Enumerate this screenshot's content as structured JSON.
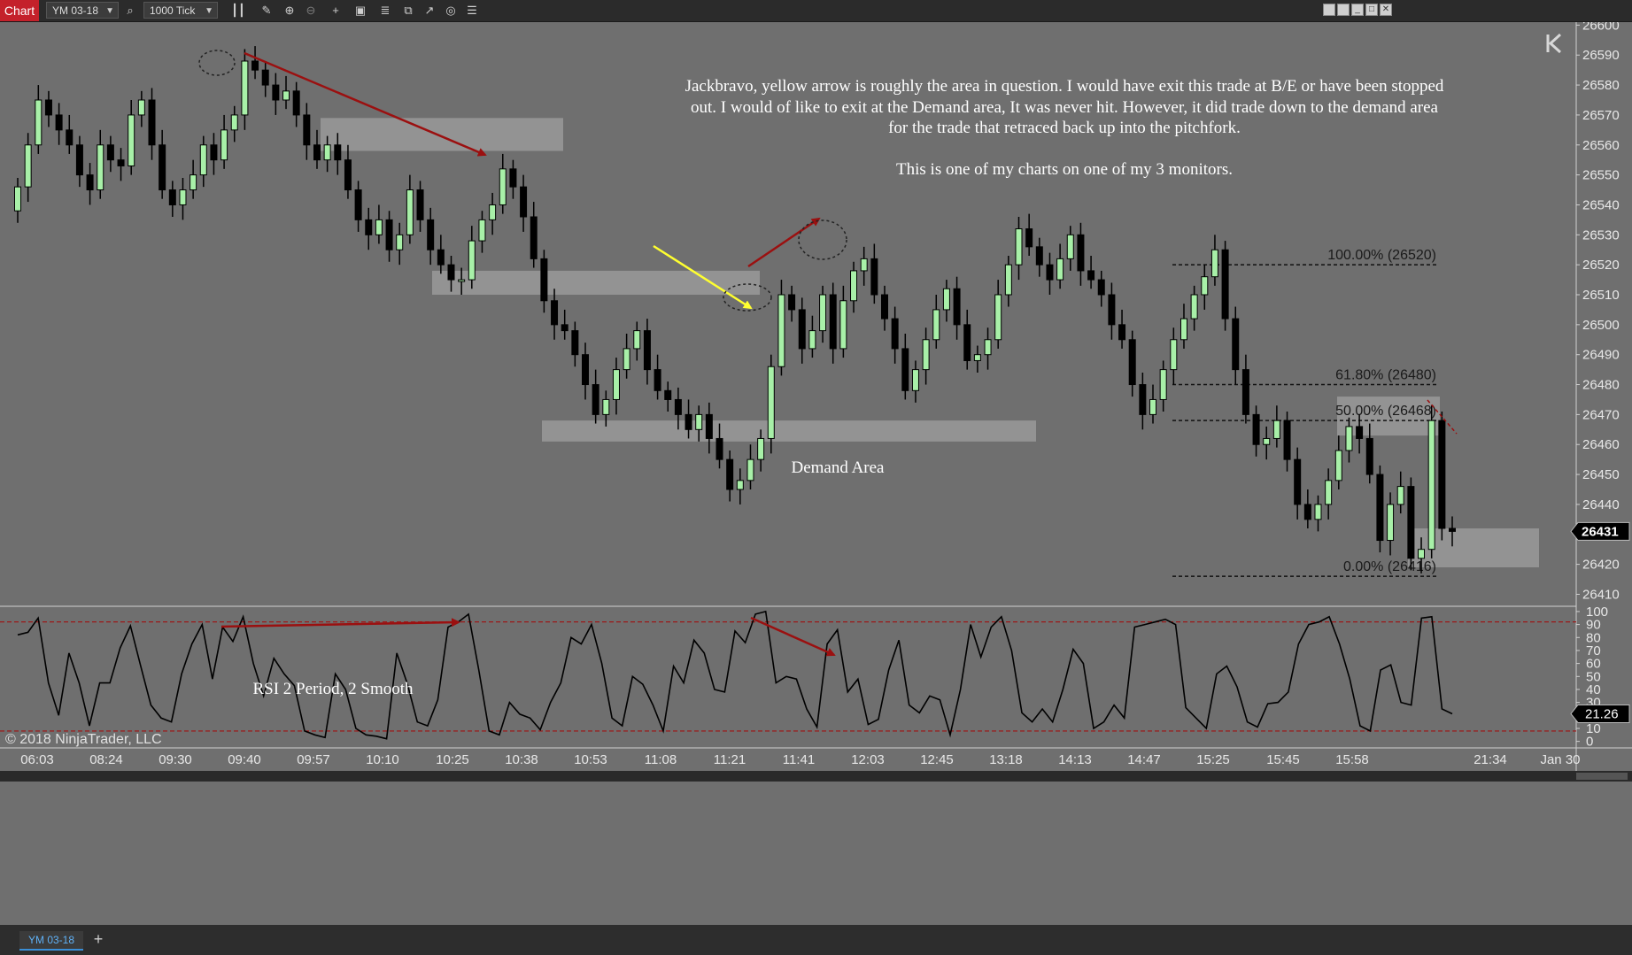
{
  "toolbar": {
    "chart_tab": "Chart",
    "instrument": "YM 03-18",
    "interval": "1000 Tick"
  },
  "bottom": {
    "instrument_tab": "YM 03-18",
    "add_tab": "+"
  },
  "annotations": {
    "note_lines": [
      "Jackbravo, yellow arrow is roughly the area in question.  I would have exit this trade at B/E or have been stopped",
      "out. I would of like to exit at the Demand area, It was never hit. However, it did trade down to the demand area",
      "for the trade that retraced back up into the pitchfork.",
      "",
      "This is one of my charts on one of my 3 monitors."
    ],
    "demand_label": "Demand Area",
    "rsi_label": "RSI 2 Period, 2 Smooth",
    "copyright": "© 2018 NinjaTrader, LLC"
  },
  "colors": {
    "background": "#6f6f6f",
    "up_candle": "#a8f0a8",
    "down_candle": "#000000",
    "zone": "#9a9a9a",
    "red_arrow": "#9b1010",
    "yellow_arrow": "#ffff30",
    "rsi_line": "#000000",
    "rsi_level": "#a01010"
  },
  "chart_data": [
    {
      "type": "candlestick",
      "y_axis_ticks": [
        26600,
        26590,
        26580,
        26570,
        26560,
        26550,
        26540,
        26530,
        26520,
        26510,
        26500,
        26490,
        26480,
        26470,
        26460,
        26450,
        26440,
        26430,
        26420,
        26410
      ],
      "ylim": [
        26406,
        26601
      ],
      "last_price": "26431",
      "x_tick_labels": [
        "06:03",
        "08:24",
        "09:30",
        "09:40",
        "09:57",
        "10:10",
        "10:25",
        "10:38",
        "10:53",
        "11:08",
        "11:21",
        "11:41",
        "12:03",
        "12:45",
        "13:18",
        "14:13",
        "14:47",
        "15:25",
        "15:45",
        "15:58",
        "21:34",
        "Jan 30"
      ],
      "fib_levels": [
        {
          "label": "100.00% (26520)",
          "price": 26520
        },
        {
          "label": "61.80% (26480)",
          "price": 26480
        },
        {
          "label": "50.00% (26468)",
          "price": 26468
        },
        {
          "label": "0.00% (26416)",
          "price": 26416
        }
      ],
      "zones": [
        {
          "price_low": 26558,
          "price_high": 26569
        },
        {
          "price_low": 26510,
          "price_high": 26518
        },
        {
          "price_low": 26461,
          "price_high": 26468
        },
        {
          "price_low": 26419,
          "price_high": 26432
        },
        {
          "price_low": 26463,
          "price_high": 26476
        }
      ],
      "close": [
        26546,
        26560,
        26575,
        26570,
        26565,
        26560,
        26550,
        26545,
        26560,
        26555,
        26553,
        26570,
        26575,
        26560,
        26545,
        26540,
        26545,
        26550,
        26560,
        26555,
        26565,
        26570,
        26588,
        26585,
        26580,
        26575,
        26578,
        26570,
        26560,
        26555,
        26560,
        26555,
        26545,
        26535,
        26530,
        26535,
        26525,
        26530,
        26545,
        26535,
        26525,
        26520,
        26515,
        26515,
        26528,
        26535,
        26540,
        26552,
        26546,
        26536,
        26522,
        26508,
        26500,
        26498,
        26490,
        26480,
        26470,
        26475,
        26485,
        26492,
        26498,
        26485,
        26478,
        26475,
        26470,
        26465,
        26470,
        26462,
        26455,
        26445,
        26448,
        26455,
        26462,
        26486,
        26510,
        26505,
        26492,
        26498,
        26510,
        26492,
        26508,
        26518,
        26522,
        26510,
        26502,
        26492,
        26478,
        26485,
        26495,
        26505,
        26512,
        26500,
        26488,
        26490,
        26495,
        26510,
        26520,
        26532,
        26526,
        26520,
        26515,
        26522,
        26530,
        26518,
        26515,
        26510,
        26500,
        26495,
        26480,
        26470,
        26475,
        26485,
        26495,
        26502,
        26510,
        26516,
        26525,
        26502,
        26485,
        26470,
        26460,
        26462,
        26468,
        26455,
        26440,
        26435,
        26440,
        26448,
        26458,
        26466,
        26462,
        26450,
        26428,
        26440,
        26446,
        26422,
        26425,
        26468,
        26432,
        26431
      ]
    },
    {
      "type": "line",
      "name": "RSI 2 Period, 2 Smooth",
      "y_axis_ticks": [
        100,
        90,
        80,
        70,
        60,
        50,
        40,
        30,
        20,
        10,
        0
      ],
      "ylim": [
        -5,
        102
      ],
      "levels": [
        92,
        8
      ],
      "last_value": "21.26",
      "values": [
        82,
        84,
        95,
        45,
        20,
        68,
        45,
        12,
        45,
        45,
        72,
        89,
        58,
        28,
        18,
        15,
        52,
        75,
        90,
        48,
        88,
        77,
        96,
        60,
        35,
        64,
        52,
        43,
        8,
        5,
        3,
        52,
        40,
        10,
        5,
        4,
        2,
        68,
        45,
        15,
        12,
        32,
        88,
        92,
        98,
        55,
        8,
        5,
        30,
        21,
        18,
        9,
        30,
        45,
        80,
        75,
        90,
        60,
        18,
        12,
        50,
        44,
        28,
        8,
        58,
        45,
        78,
        68,
        40,
        38,
        85,
        76,
        98,
        100,
        45,
        50,
        48,
        25,
        11,
        75,
        86,
        38,
        48,
        13,
        17,
        55,
        78,
        28,
        22,
        35,
        32,
        5,
        40,
        90,
        65,
        88,
        96,
        70,
        22,
        15,
        25,
        15,
        40,
        71,
        60,
        10,
        15,
        28,
        18,
        88,
        90,
        92,
        94,
        90,
        26,
        18,
        10,
        52,
        58,
        42,
        15,
        11,
        29,
        30,
        38,
        75,
        90,
        92,
        96,
        75,
        48,
        12,
        8,
        55,
        59,
        30,
        28,
        95,
        96,
        25,
        21.26
      ]
    }
  ]
}
